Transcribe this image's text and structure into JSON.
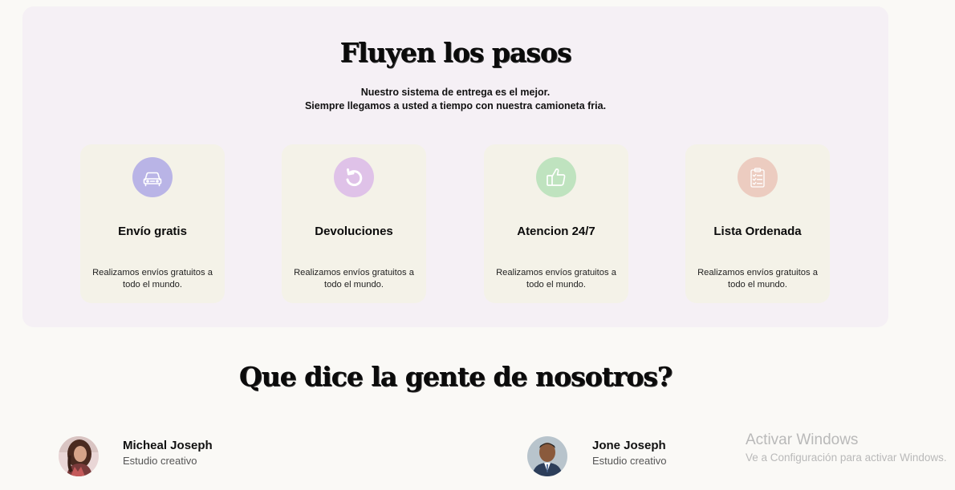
{
  "steps": {
    "title": "Fluyen los pasos",
    "subtitle_line1": "Nuestro sistema de entrega es el mejor.",
    "subtitle_line2": "Siempre llegamos a usted a tiempo con nuestra camioneta fria.",
    "cards": [
      {
        "title": "Envío gratis",
        "text": "Realizamos envíos gratuitos a todo el mundo.",
        "icon": "car-icon",
        "color": "#b9b4e6"
      },
      {
        "title": "Devoluciones",
        "text": "Realizamos envíos gratuitos a todo el mundo.",
        "icon": "undo-icon",
        "color": "#dfc2e8"
      },
      {
        "title": "Atencion 24/7",
        "text": "Realizamos envíos gratuitos a todo el mundo.",
        "icon": "thumbs-up-icon",
        "color": "#bfe3bf"
      },
      {
        "title": "Lista Ordenada",
        "text": "Realizamos envíos gratuitos a todo el mundo.",
        "icon": "clipboard-list-icon",
        "color": "#ecccc0"
      }
    ]
  },
  "testimonials": {
    "title": "Que dice la gente de nosotros?",
    "people": [
      {
        "name": "Micheal Joseph",
        "role": "Estudio creativo"
      },
      {
        "name": "Jone Joseph",
        "role": "Estudio creativo"
      }
    ]
  },
  "watermark": {
    "title": "Activar Windows",
    "subtitle": "Ve a Configuración para activar Windows."
  }
}
